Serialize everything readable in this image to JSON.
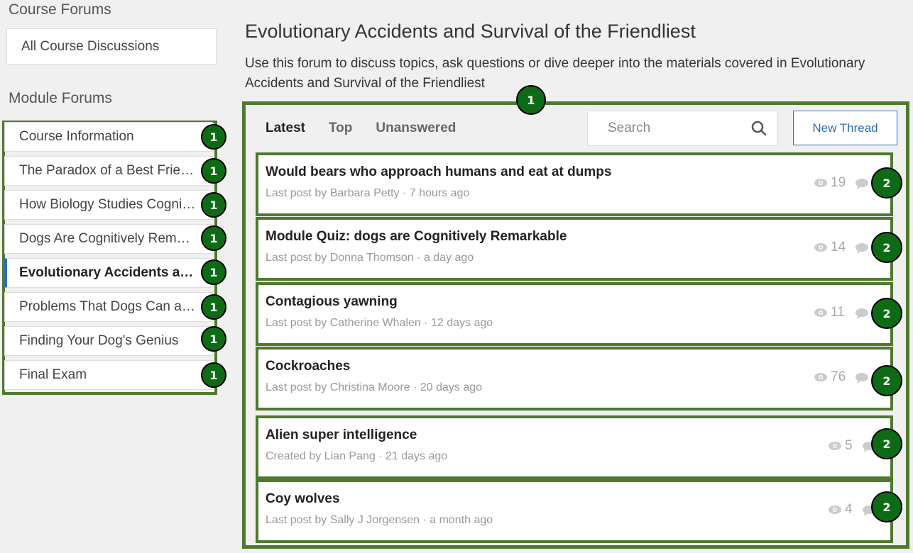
{
  "sidebar": {
    "course_heading": "Course Forums",
    "all_discussions": "All Course Discussions",
    "module_heading": "Module Forums",
    "modules": [
      {
        "label": "Course Information",
        "badge": "1"
      },
      {
        "label": "The Paradox of a Best Frien…",
        "badge": "1"
      },
      {
        "label": "How Biology Studies Cognit…",
        "badge": "1"
      },
      {
        "label": "Dogs Are Cognitively Remar…",
        "badge": "1"
      },
      {
        "label": "Evolutionary Accidents a…",
        "badge": "1"
      },
      {
        "label": "Problems That Dogs Can an…",
        "badge": "1"
      },
      {
        "label": "Finding Your Dog's Genius",
        "badge": "1"
      },
      {
        "label": "Final Exam",
        "badge": "1"
      }
    ]
  },
  "main": {
    "title": "Evolutionary Accidents and Survival of the Friendliest",
    "description": "Use this forum to discuss topics, ask questions or dive deeper into the materials covered in Evolutionary Accidents and Survival of the Friendliest",
    "panel_badge": "1",
    "tabs": [
      {
        "label": "Latest"
      },
      {
        "label": "Top"
      },
      {
        "label": "Unanswered"
      }
    ],
    "search_placeholder": "Search",
    "new_thread_label": "New Thread"
  },
  "threads": [
    {
      "title": "Would bears who approach humans and eat at dumps",
      "meta": "Last post by Barbara Petty · 7 hours ago",
      "views": "19",
      "badge": "2"
    },
    {
      "title": "Module Quiz: dogs are Cognitively Remarkable",
      "meta": "Last post by Donna Thomson · a day ago",
      "views": "14",
      "badge": "2"
    },
    {
      "title": "Contagious yawning",
      "meta": "Last post by Catherine Whalen · 12 days ago",
      "views": "11",
      "badge": "2"
    },
    {
      "title": "Cockroaches",
      "meta": "Last post by Christina Moore · 20 days ago",
      "views": "76",
      "badge": "2"
    },
    {
      "title": "Alien super intelligence",
      "meta": "Created by Lian Pang · 21 days ago",
      "views": "5",
      "badge": "2"
    },
    {
      "title": "Coy wolves",
      "meta": "Last post by Sally J Jorgensen · a month ago",
      "views": "4",
      "badge": "2"
    }
  ],
  "colors": {
    "highlight_border": "#4f7a2e",
    "badge_fill": "#0e6b15",
    "accent_blue": "#2a6ebb"
  }
}
